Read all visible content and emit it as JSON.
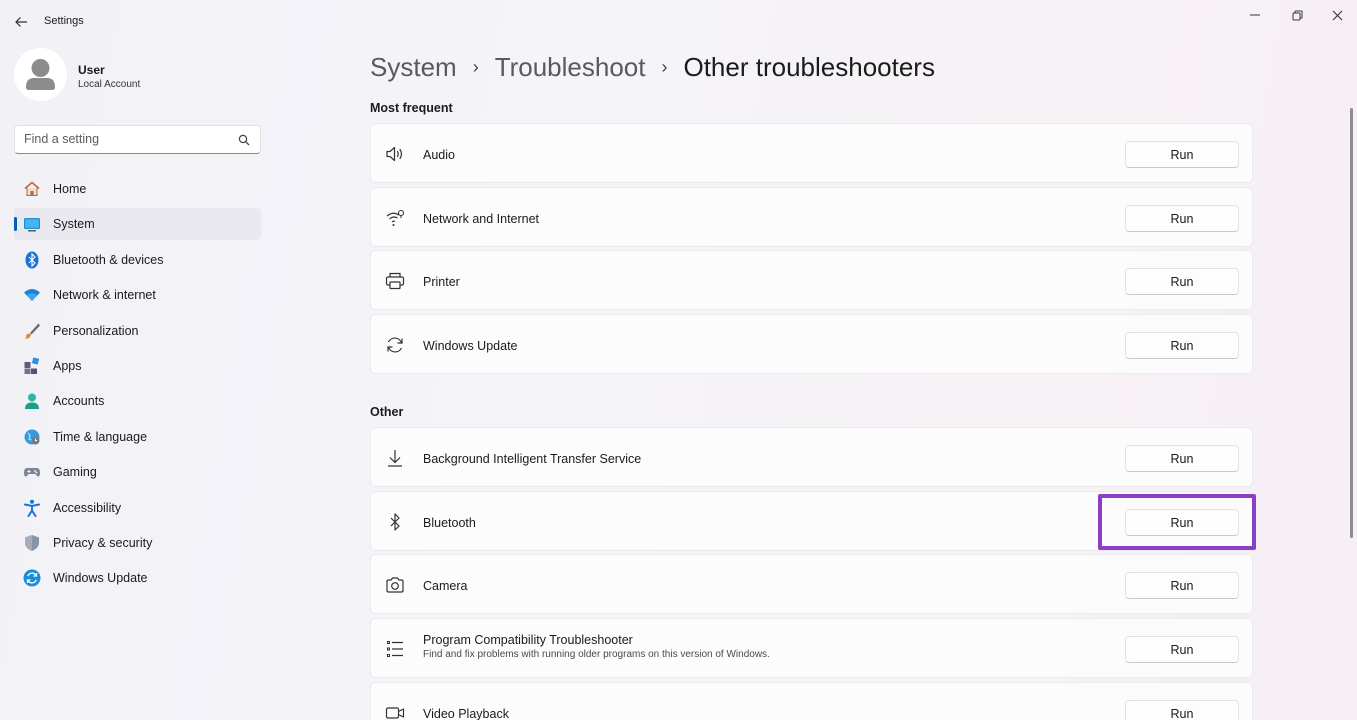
{
  "window": {
    "title": "Settings",
    "controls": [
      "minimize",
      "maximize",
      "close"
    ]
  },
  "profile": {
    "name": "User",
    "account_type": "Local Account"
  },
  "search": {
    "placeholder": "Find a setting"
  },
  "sidebar": {
    "items": [
      {
        "label": "Home",
        "icon": "home-icon",
        "selected": false
      },
      {
        "label": "System",
        "icon": "system-icon",
        "selected": true
      },
      {
        "label": "Bluetooth & devices",
        "icon": "bluetooth-devices-icon",
        "selected": false
      },
      {
        "label": "Network & internet",
        "icon": "network-icon",
        "selected": false
      },
      {
        "label": "Personalization",
        "icon": "brush-icon",
        "selected": false
      },
      {
        "label": "Apps",
        "icon": "apps-icon",
        "selected": false
      },
      {
        "label": "Accounts",
        "icon": "accounts-icon",
        "selected": false
      },
      {
        "label": "Time & language",
        "icon": "globe-clock-icon",
        "selected": false
      },
      {
        "label": "Gaming",
        "icon": "gamepad-icon",
        "selected": false
      },
      {
        "label": "Accessibility",
        "icon": "accessibility-icon",
        "selected": false
      },
      {
        "label": "Privacy & security",
        "icon": "shield-icon",
        "selected": false
      },
      {
        "label": "Windows Update",
        "icon": "update-icon",
        "selected": false
      }
    ]
  },
  "breadcrumb": {
    "items": [
      "System",
      "Troubleshoot"
    ],
    "current": "Other troubleshooters",
    "separator": "›"
  },
  "sections": {
    "most_frequent": {
      "title": "Most frequent",
      "items": [
        {
          "title": "Audio",
          "icon": "speaker-icon",
          "button": "Run"
        },
        {
          "title": "Network and Internet",
          "icon": "wifi-icon",
          "button": "Run"
        },
        {
          "title": "Printer",
          "icon": "printer-icon",
          "button": "Run"
        },
        {
          "title": "Windows Update",
          "icon": "refresh-icon",
          "button": "Run"
        }
      ]
    },
    "other": {
      "title": "Other",
      "items": [
        {
          "title": "Background Intelligent Transfer Service",
          "icon": "download-icon",
          "button": "Run"
        },
        {
          "title": "Bluetooth",
          "icon": "bluetooth-icon",
          "button": "Run",
          "highlighted": true
        },
        {
          "title": "Camera",
          "icon": "camera-icon",
          "button": "Run"
        },
        {
          "title": "Program Compatibility Troubleshooter",
          "description": "Find and fix problems with running older programs on this version of Windows.",
          "icon": "list-icon",
          "button": "Run"
        },
        {
          "title": "Video Playback",
          "icon": "video-icon",
          "button": "Run"
        }
      ]
    }
  },
  "colors": {
    "accent": "#005fb8",
    "highlight_box": "#8a3fc4"
  }
}
